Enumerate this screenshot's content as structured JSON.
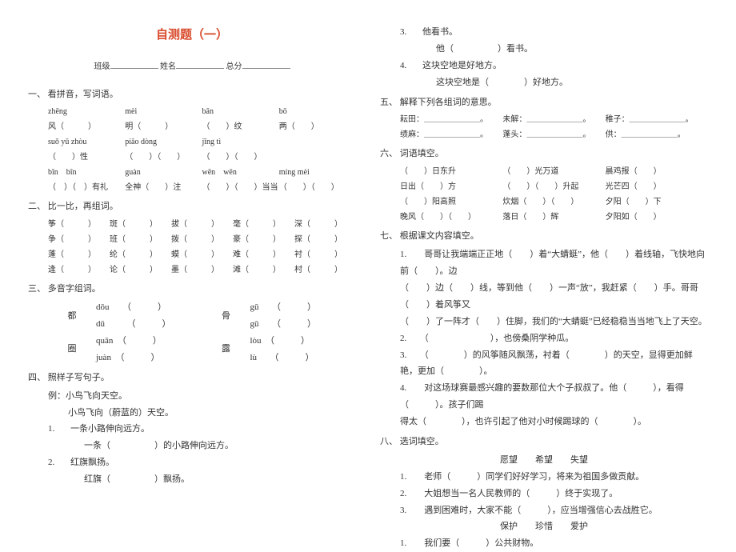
{
  "title": "自测题（一）",
  "sub_labels": {
    "class": "班级",
    "name": "姓名",
    "score": "总分"
  },
  "sections": {
    "s1": "一、 看拼音，写词语。",
    "s2": "二、 比一比，再组词。",
    "s3": "三、 多音字组词。",
    "s4": "四、 照样子写句子。",
    "s5": "五、 解释下列各组词的意思。",
    "s6": "六、 词语填空。",
    "s7": "七、 根据课文内容填空。",
    "s8": "八、 选词填空。"
  },
  "pinyin": {
    "r1": [
      "zhēng",
      "mèi",
      "bān",
      "bō"
    ],
    "r1b": [
      "风（　　　）",
      "明（　　　）",
      "（　　）纹",
      "两（　　）"
    ],
    "r2": [
      "suǒ yǔ zhòu",
      "piāo dòng",
      "jīng tì",
      ""
    ],
    "r2b": [
      "（　　）性",
      "（　　）（　　）",
      "（　　）（　　）",
      ""
    ],
    "r3": [
      "bīn　bīn",
      "guàn",
      "wēn　wēn",
      "míng mèi"
    ],
    "r3b": [
      "（　）（　）有礼",
      "全神（　　）注",
      "（　　）（　　）当当",
      "（　　）（　　）"
    ]
  },
  "bibi": {
    "r1": [
      "筝（　　　）",
      "斑（　　　）",
      "拔（　　　）",
      "毫（　　　）",
      "深（　　　）"
    ],
    "r2": [
      "争（　　　）",
      "班（　　　）",
      "拨（　　　）",
      "豪（　　　）",
      "探（　　　）"
    ],
    "r3": [
      "蓬（　　　）",
      "纶（　　　）",
      "蟆（　　　）",
      "难（　　　）",
      "衬（　　　）"
    ],
    "r4": [
      "逢（　　　）",
      "论（　　　）",
      "墨（　　　）",
      "滩（　　　）",
      "村（　　　）"
    ]
  },
  "duo": [
    {
      "char": "都",
      "a": "dōu　　（　　　）",
      "b": "dū　　　（　　　）",
      "char2": "骨",
      "a2": "gū　　（　　　）",
      "b2": "gǔ　　（　　　）"
    },
    {
      "char": "圈",
      "a": "quān　（　　　）",
      "b": "juàn　（　　　）",
      "char2": "露",
      "a2": "lòu　（　　　）",
      "b2": "lù　　（　　　）"
    }
  ],
  "s4": {
    "ex_label": "例：",
    "ex1a": "小鸟飞向天空。",
    "ex1b": "小鸟飞向（蔚蓝的）天空。",
    "items": [
      {
        "n": "1.",
        "a": "一条小路伸向远方。",
        "b": "一条（　　　　　）的小路伸向远方。"
      },
      {
        "n": "2.",
        "a": "红旗飘扬。",
        "b": "红旗（　　　　　）飘扬。"
      },
      {
        "n": "3.",
        "a": "他看书。",
        "b": "他（　　　　　）看书。"
      },
      {
        "n": "4.",
        "a": "这块空地是好地方。",
        "b": "这块空地是（　　　　）好地方。"
      }
    ]
  },
  "s5": {
    "r1": [
      "耘田：＿＿＿＿＿＿＿。",
      "未解：＿＿＿＿＿＿＿。",
      "稚子：＿＿＿＿＿＿＿。"
    ],
    "r2": [
      "绩麻：＿＿＿＿＿＿＿。",
      "蓬头：＿＿＿＿＿＿＿。",
      "供：＿＿＿＿＿＿＿。"
    ]
  },
  "s6": [
    [
      "（　　）日东升",
      "（　　）光万道",
      "晨鸡报（　　）"
    ],
    [
      "日出（　　）方",
      "（　　）（　　）升起",
      "光芒四（　　）"
    ],
    [
      "（　　）阳高照",
      "炊烟（　　）（　　）",
      "夕阳（　　）下"
    ],
    [
      "晚风（　　）（　　）",
      "落日（　　）辉",
      "夕阳如（　　）"
    ]
  ],
  "s7": {
    "l1": "1.　　哥哥让我端端正正地（　　）着“大蜻蜓”，他（　　）着线轴，飞快地向前（　　）。边",
    "l2": "（　　）边（　　）线，等到他（　　）一声“放”，我赶紧（　　）手。哥哥（　　）着风筝又",
    "l3": "（　　）了一阵才（　　）住脚，我们的“大蜻蜓”已经稳稳当当地飞上了天空。",
    "l4": "2.　　（　　　　　　　），也傍桑阴学种瓜。",
    "l5": "3.　　（　　　　）的风筝随风飘荡，衬着（　　　　）的天空，显得更加鲜艳，更加（　　　　）。",
    "l6": "4.　　对这场球赛最感兴趣的要数那位大个子叔叔了。他（　　　），看得（　　　）。孩子们踢",
    "l7": "得太（　　　　），也许引起了他对小时候踢球的（　　　　）。"
  },
  "s8": {
    "group1": "愿望　　希望　　失望",
    "group1_items": [
      "1.　　老师（　　　）同学们好好学习，将来为祖国多做贡献。",
      "2.　　大姐想当一名人民教师的（　　　）终于实现了。",
      "3.　　遇到困难时，大家不能（　　　），应当增强信心去战胜它。"
    ],
    "group2": "保护　　珍惜　　爱护",
    "group2_items": [
      "1.　　我们要（　　　）公共财物。"
    ]
  }
}
